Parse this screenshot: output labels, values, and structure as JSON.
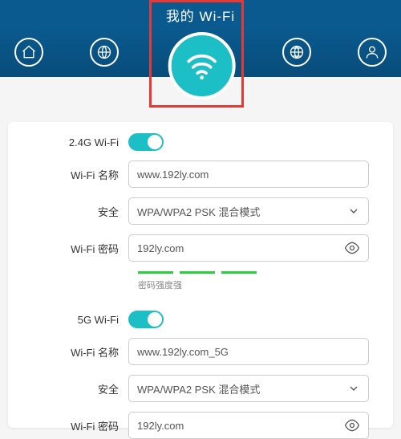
{
  "header": {
    "title": "我的 Wi-Fi"
  },
  "nav": {
    "home": "home-icon",
    "globe1": "globe-icon",
    "globe2": "globe-icon",
    "user": "user-icon"
  },
  "wifi24": {
    "section_label": "2.4G Wi-Fi",
    "name_label": "Wi-Fi 名称",
    "name_value": "www.192ly.com",
    "security_label": "安全",
    "security_value": "WPA/WPA2 PSK 混合模式",
    "password_label": "Wi-Fi 密码",
    "password_value": "192ly.com",
    "strength_label": "密码强度强"
  },
  "wifi5": {
    "section_label": "5G Wi-Fi",
    "name_label": "Wi-Fi 名称",
    "name_value": "www.192ly.com_5G",
    "security_label": "安全",
    "security_value": "WPA/WPA2 PSK 混合模式",
    "password_label": "Wi-Fi 密码",
    "password_value": "192ly.com"
  }
}
